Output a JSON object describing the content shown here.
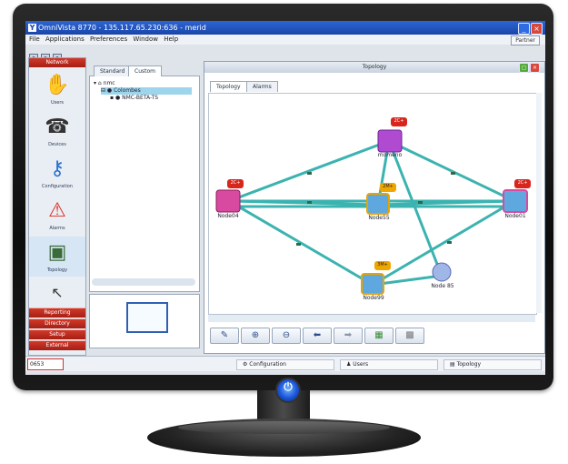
{
  "window": {
    "title": "OmniVista 8770 - 135.117.65.230:636 - merid",
    "logo_glyph": "Y"
  },
  "menu": [
    "File",
    "Applications",
    "Preferences",
    "Window",
    "Help"
  ],
  "partner_label": "Partner",
  "nav": {
    "header": "Network",
    "items": [
      {
        "label": "Users",
        "icon": "user-icon",
        "glyph": "✋"
      },
      {
        "label": "Devices",
        "icon": "phone-icon",
        "glyph": "☎"
      },
      {
        "label": "Configuration",
        "icon": "keys-icon",
        "glyph": "⚷"
      },
      {
        "label": "Alarms",
        "icon": "alarm-icon",
        "glyph": "⚠"
      },
      {
        "label": "Topology",
        "icon": "topology-icon",
        "glyph": "▣"
      },
      {
        "label": "",
        "icon": "cursor-icon",
        "glyph": "↖"
      }
    ],
    "sections": [
      "Reporting",
      "Directory",
      "Setup",
      "External"
    ]
  },
  "tree": {
    "tabs": [
      "Standard",
      "Custom"
    ],
    "rows": [
      {
        "label": "nmc",
        "selected": false
      },
      {
        "label": "Colombes",
        "selected": true
      },
      {
        "label": "NMC-BETA-TS",
        "selected": false
      }
    ]
  },
  "topology": {
    "title": "Topology",
    "tabs": [
      "Topology",
      "Alarms"
    ],
    "nodes": [
      {
        "id": "momeno",
        "label": "momeno",
        "badge": "2C+",
        "badge_color": "#d8261c"
      },
      {
        "id": "node04",
        "label": "Node04",
        "badge": "2C+",
        "badge_color": "#d8261c"
      },
      {
        "id": "node55",
        "label": "Node55",
        "badge": "2M+",
        "badge_color": "#f0a600"
      },
      {
        "id": "node01",
        "label": "Node01",
        "badge": "2C+",
        "badge_color": "#d8261c"
      },
      {
        "id": "node99",
        "label": "Node99",
        "badge": "3M+",
        "badge_color": "#f0a600"
      },
      {
        "id": "node85",
        "label": "Node 85",
        "badge": "",
        "badge_color": ""
      }
    ],
    "link_color": "#3bb3b0",
    "toolbar": [
      "pencil-icon",
      "zoom-in-icon",
      "zoom-out-icon",
      "back-arrow-icon",
      "forward-arrow-icon",
      "export-icon",
      "grid-icon"
    ]
  },
  "status": {
    "count": "0653",
    "items": [
      "Configuration",
      "Users",
      "Topology"
    ]
  },
  "colors": {
    "accent_red": "#c62a1f",
    "title_blue": "#1f4fb8"
  }
}
